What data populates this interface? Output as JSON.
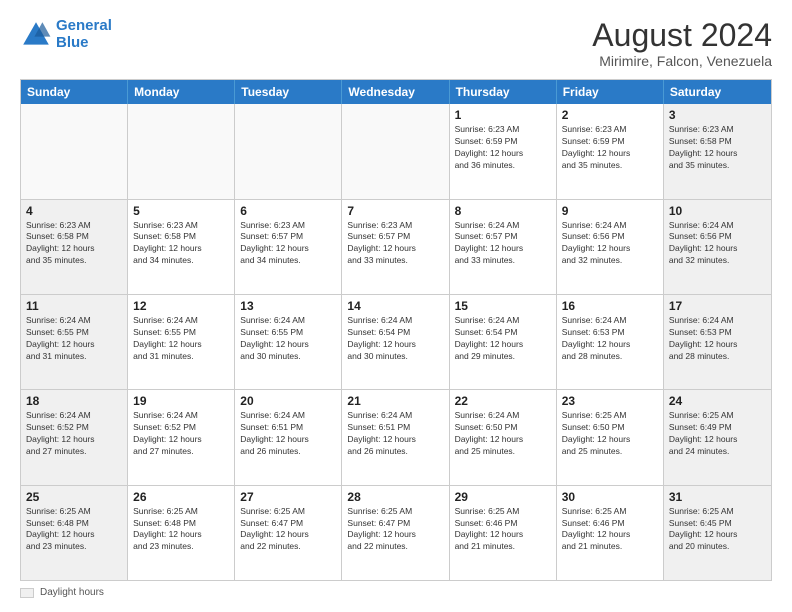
{
  "logo": {
    "line1": "General",
    "line2": "Blue"
  },
  "title": "August 2024",
  "location": "Mirimire, Falcon, Venezuela",
  "days_of_week": [
    "Sunday",
    "Monday",
    "Tuesday",
    "Wednesday",
    "Thursday",
    "Friday",
    "Saturday"
  ],
  "footer_label": "Daylight hours",
  "weeks": [
    [
      {
        "day": "",
        "info": ""
      },
      {
        "day": "",
        "info": ""
      },
      {
        "day": "",
        "info": ""
      },
      {
        "day": "",
        "info": ""
      },
      {
        "day": "1",
        "info": "Sunrise: 6:23 AM\nSunset: 6:59 PM\nDaylight: 12 hours\nand 36 minutes."
      },
      {
        "day": "2",
        "info": "Sunrise: 6:23 AM\nSunset: 6:59 PM\nDaylight: 12 hours\nand 35 minutes."
      },
      {
        "day": "3",
        "info": "Sunrise: 6:23 AM\nSunset: 6:58 PM\nDaylight: 12 hours\nand 35 minutes."
      }
    ],
    [
      {
        "day": "4",
        "info": "Sunrise: 6:23 AM\nSunset: 6:58 PM\nDaylight: 12 hours\nand 35 minutes."
      },
      {
        "day": "5",
        "info": "Sunrise: 6:23 AM\nSunset: 6:58 PM\nDaylight: 12 hours\nand 34 minutes."
      },
      {
        "day": "6",
        "info": "Sunrise: 6:23 AM\nSunset: 6:57 PM\nDaylight: 12 hours\nand 34 minutes."
      },
      {
        "day": "7",
        "info": "Sunrise: 6:23 AM\nSunset: 6:57 PM\nDaylight: 12 hours\nand 33 minutes."
      },
      {
        "day": "8",
        "info": "Sunrise: 6:24 AM\nSunset: 6:57 PM\nDaylight: 12 hours\nand 33 minutes."
      },
      {
        "day": "9",
        "info": "Sunrise: 6:24 AM\nSunset: 6:56 PM\nDaylight: 12 hours\nand 32 minutes."
      },
      {
        "day": "10",
        "info": "Sunrise: 6:24 AM\nSunset: 6:56 PM\nDaylight: 12 hours\nand 32 minutes."
      }
    ],
    [
      {
        "day": "11",
        "info": "Sunrise: 6:24 AM\nSunset: 6:55 PM\nDaylight: 12 hours\nand 31 minutes."
      },
      {
        "day": "12",
        "info": "Sunrise: 6:24 AM\nSunset: 6:55 PM\nDaylight: 12 hours\nand 31 minutes."
      },
      {
        "day": "13",
        "info": "Sunrise: 6:24 AM\nSunset: 6:55 PM\nDaylight: 12 hours\nand 30 minutes."
      },
      {
        "day": "14",
        "info": "Sunrise: 6:24 AM\nSunset: 6:54 PM\nDaylight: 12 hours\nand 30 minutes."
      },
      {
        "day": "15",
        "info": "Sunrise: 6:24 AM\nSunset: 6:54 PM\nDaylight: 12 hours\nand 29 minutes."
      },
      {
        "day": "16",
        "info": "Sunrise: 6:24 AM\nSunset: 6:53 PM\nDaylight: 12 hours\nand 28 minutes."
      },
      {
        "day": "17",
        "info": "Sunrise: 6:24 AM\nSunset: 6:53 PM\nDaylight: 12 hours\nand 28 minutes."
      }
    ],
    [
      {
        "day": "18",
        "info": "Sunrise: 6:24 AM\nSunset: 6:52 PM\nDaylight: 12 hours\nand 27 minutes."
      },
      {
        "day": "19",
        "info": "Sunrise: 6:24 AM\nSunset: 6:52 PM\nDaylight: 12 hours\nand 27 minutes."
      },
      {
        "day": "20",
        "info": "Sunrise: 6:24 AM\nSunset: 6:51 PM\nDaylight: 12 hours\nand 26 minutes."
      },
      {
        "day": "21",
        "info": "Sunrise: 6:24 AM\nSunset: 6:51 PM\nDaylight: 12 hours\nand 26 minutes."
      },
      {
        "day": "22",
        "info": "Sunrise: 6:24 AM\nSunset: 6:50 PM\nDaylight: 12 hours\nand 25 minutes."
      },
      {
        "day": "23",
        "info": "Sunrise: 6:25 AM\nSunset: 6:50 PM\nDaylight: 12 hours\nand 25 minutes."
      },
      {
        "day": "24",
        "info": "Sunrise: 6:25 AM\nSunset: 6:49 PM\nDaylight: 12 hours\nand 24 minutes."
      }
    ],
    [
      {
        "day": "25",
        "info": "Sunrise: 6:25 AM\nSunset: 6:48 PM\nDaylight: 12 hours\nand 23 minutes."
      },
      {
        "day": "26",
        "info": "Sunrise: 6:25 AM\nSunset: 6:48 PM\nDaylight: 12 hours\nand 23 minutes."
      },
      {
        "day": "27",
        "info": "Sunrise: 6:25 AM\nSunset: 6:47 PM\nDaylight: 12 hours\nand 22 minutes."
      },
      {
        "day": "28",
        "info": "Sunrise: 6:25 AM\nSunset: 6:47 PM\nDaylight: 12 hours\nand 22 minutes."
      },
      {
        "day": "29",
        "info": "Sunrise: 6:25 AM\nSunset: 6:46 PM\nDaylight: 12 hours\nand 21 minutes."
      },
      {
        "day": "30",
        "info": "Sunrise: 6:25 AM\nSunset: 6:46 PM\nDaylight: 12 hours\nand 21 minutes."
      },
      {
        "day": "31",
        "info": "Sunrise: 6:25 AM\nSunset: 6:45 PM\nDaylight: 12 hours\nand 20 minutes."
      }
    ]
  ]
}
